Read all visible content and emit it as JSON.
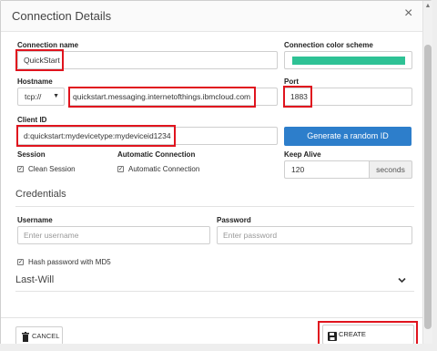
{
  "dialog": {
    "title": "Connection Details",
    "close_glyph": "×"
  },
  "fields": {
    "connection_name": {
      "label": "Connection name",
      "value": "QuickStart"
    },
    "color_scheme": {
      "label": "Connection color scheme",
      "color": "#2ec295"
    },
    "hostname": {
      "label": "Hostname",
      "protocol": "tcp://",
      "value": "quickstart.messaging.internetofthings.ibmcloud.com"
    },
    "port": {
      "label": "Port",
      "value": "1883"
    },
    "client_id": {
      "label": "Client ID",
      "value": "d:quickstart:mydevicetype:mydeviceid1234"
    },
    "generate_button": "Generate a random ID",
    "session": {
      "label": "Session",
      "option": "Clean Session",
      "checked": true
    },
    "auto_connect": {
      "label": "Automatic Connection",
      "option": "Automatic Connection",
      "checked": true
    },
    "keep_alive": {
      "label": "Keep Alive",
      "value": "120",
      "unit": "seconds"
    }
  },
  "credentials": {
    "title": "Credentials",
    "username": {
      "label": "Username",
      "placeholder": "Enter username"
    },
    "password": {
      "label": "Password",
      "placeholder": "Enter password"
    },
    "hash_option": "Hash password with MD5",
    "hash_checked": true
  },
  "last_will": {
    "title": "Last-Will"
  },
  "footer": {
    "cancel_label": "CANCEL",
    "create_label": "CREATE CONNECTION"
  },
  "colors": {
    "accent": "#2d7ecb",
    "highlight": "#e0141e",
    "scheme": "#2ec295"
  }
}
